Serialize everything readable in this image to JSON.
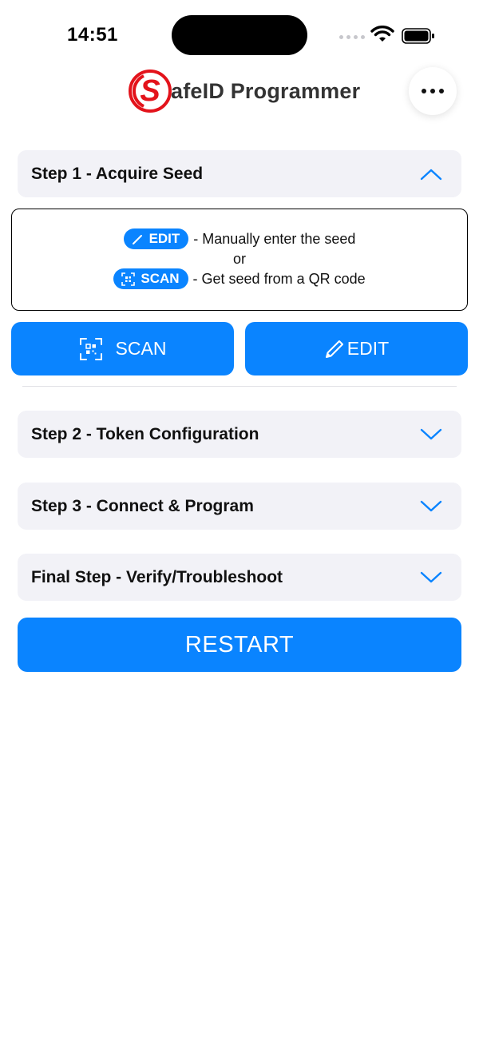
{
  "status_bar": {
    "time": "14:51"
  },
  "header": {
    "title": "afeID Programmer",
    "logo_letter": "S"
  },
  "steps": [
    {
      "label": "Step 1 - Acquire Seed",
      "expanded": true
    },
    {
      "label": "Step 2 - Token Configuration",
      "expanded": false
    },
    {
      "label": "Step 3 - Connect & Program",
      "expanded": false
    },
    {
      "label": "Final Step - Verify/Troubleshoot",
      "expanded": false
    }
  ],
  "instructions": {
    "edit_pill": "EDIT",
    "edit_text": "- Manually enter the seed",
    "or": "or",
    "scan_pill": "SCAN",
    "scan_text": "- Get seed from a QR code"
  },
  "buttons": {
    "scan": "SCAN",
    "edit": "EDIT",
    "restart": "RESTART"
  },
  "colors": {
    "accent": "#0a84ff",
    "logo_red": "#e3131b",
    "step_bg": "#f2f2f7"
  },
  "icons": [
    "wifi-icon",
    "battery-icon",
    "more-icon",
    "chevron-up-icon",
    "chevron-down-icon",
    "pencil-icon",
    "qr-scan-icon"
  ]
}
